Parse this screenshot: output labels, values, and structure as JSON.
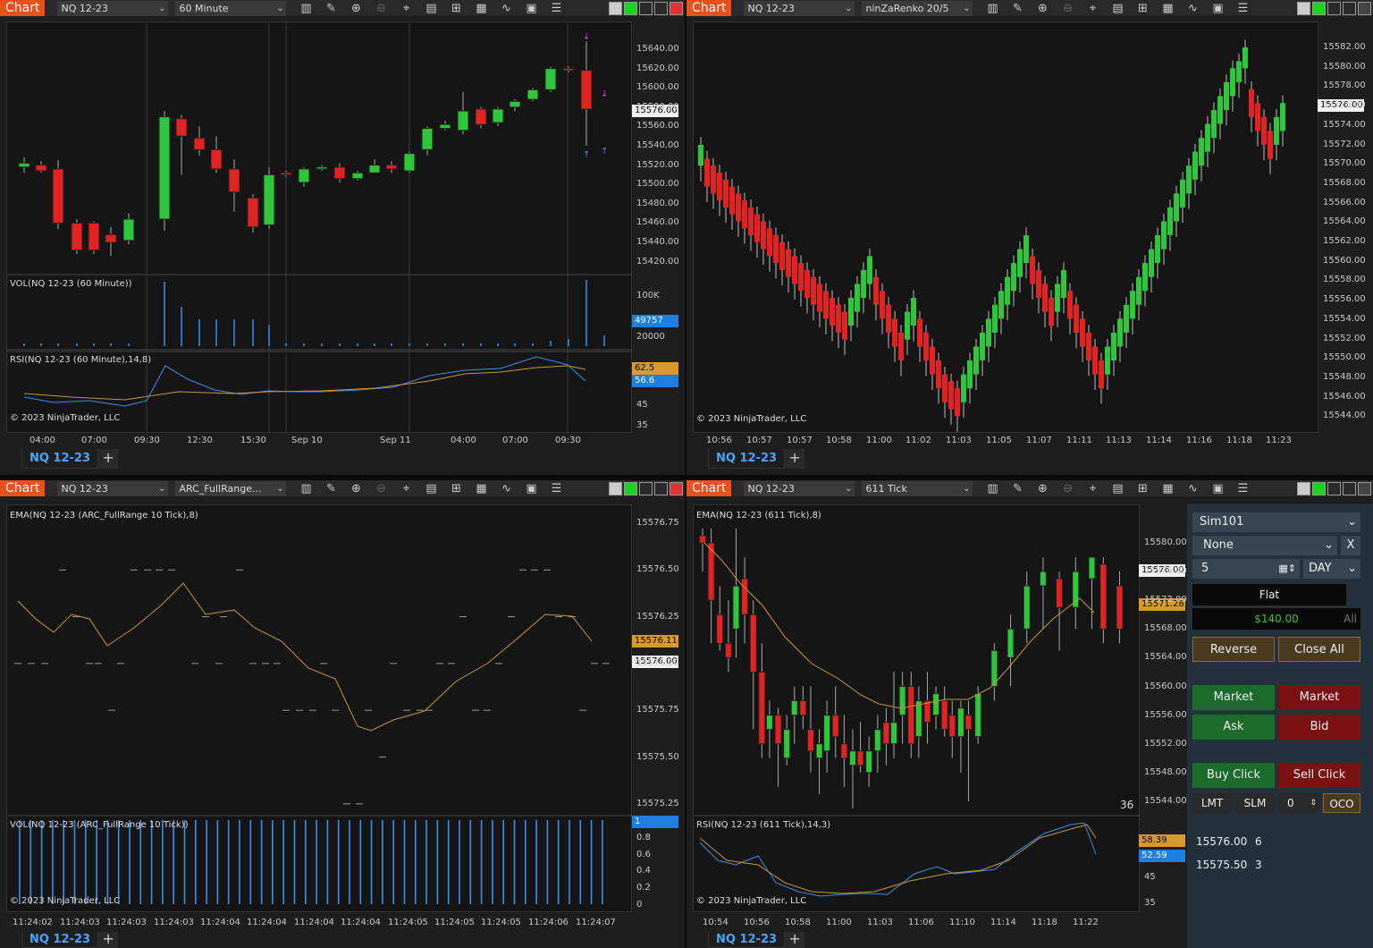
{
  "windows": [
    {
      "title": "Chart",
      "instrument": "NQ 12-23",
      "period": "60 Minute",
      "price_axis": [
        "15640.00",
        "15620.00",
        "15600.00",
        "15580.00",
        "15560.00",
        "15540.00",
        "15520.00",
        "15500.00",
        "15480.00",
        "15460.00",
        "15440.00",
        "15420.00"
      ],
      "price_tag": "15576.00",
      "vol_label": "VOL(NQ 12-23 (60 Minute))",
      "vol_axis": [
        "100K",
        "20000"
      ],
      "vol_tag": "49757",
      "rsi_label": "RSI(NQ 12-23 (60 Minute),14,8)",
      "rsi_axis": [
        "45",
        "35"
      ],
      "rsi_tag1": "62.5",
      "rsi_tag2": "56.6",
      "copyright": "© 2023 NinjaTrader, LLC",
      "time_axis": [
        "04:00",
        "07:00",
        "09:30",
        "12:30",
        "15:30",
        "Sep 10",
        "Sep 11",
        "04:00",
        "07:00",
        "09:30"
      ],
      "tab": "NQ 12-23"
    },
    {
      "title": "Chart",
      "instrument": "NQ 12-23",
      "period": "ninZaRenko 20/5",
      "price_axis": [
        "15582.00",
        "15580.00",
        "15578.00",
        "15576.00",
        "15574.00",
        "15572.00",
        "15570.00",
        "15568.00",
        "15566.00",
        "15564.00",
        "15562.00",
        "15560.00",
        "15558.00",
        "15556.00",
        "15554.00",
        "15552.00",
        "15550.00",
        "15548.00",
        "15546.00",
        "15544.00"
      ],
      "price_tag": "15576.00",
      "copyright": "© 2023 NinjaTrader, LLC",
      "time_axis": [
        "10:56",
        "10:57",
        "10:57",
        "10:58",
        "11:00",
        "11:02",
        "11:03",
        "11:05",
        "11:07",
        "11:11",
        "11:13",
        "11:14",
        "11:16",
        "11:18",
        "11:23"
      ],
      "tab": "NQ 12-23"
    },
    {
      "title": "Chart",
      "instrument": "NQ 12-23",
      "period": "ARC_FullRange...",
      "ema_label": "EMA(NQ 12-23 (ARC_FullRange  10 Tick),8)",
      "price_axis": [
        "15576.75",
        "15576.50",
        "15576.25",
        "15576.00",
        "15575.75",
        "15575.50",
        "15575.25"
      ],
      "price_tag": "15576.11",
      "price_tag2": "15576.00",
      "vol_label": "VOL(NQ 12-23 (ARC_FullRange  10 Tick))",
      "vol_axis": [
        "0.8",
        "0.6",
        "0.4",
        "0.2",
        "0"
      ],
      "vol_tag": "1",
      "copyright": "© 2023 NinjaTrader, LLC",
      "time_axis": [
        "11:24:02",
        "11:24:03",
        "11:24:03",
        "11:24:03",
        "11:24:04",
        "11:24:04",
        "11:24:04",
        "11:24:04",
        "11:24:05",
        "11:24:05",
        "11:24:05",
        "11:24:06",
        "11:24:07"
      ],
      "tab": "NQ 12-23"
    },
    {
      "title": "Chart",
      "instrument": "NQ 12-23",
      "period": "611 Tick",
      "ema_label": "EMA(NQ 12-23 (611 Tick),8)",
      "price_axis": [
        "15580.00",
        "15576.00",
        "15572.00",
        "15568.00",
        "15564.00",
        "15560.00",
        "15556.00",
        "15552.00",
        "15548.00",
        "15544.00"
      ],
      "price_tag": "15576.00",
      "price_tag2": "15571.28",
      "bar_count": "36",
      "rsi_label": "RSI(NQ 12-23 (611 Tick),14,3)",
      "rsi_axis": [
        "45",
        "35"
      ],
      "rsi_tag1": "58.39",
      "rsi_tag2": "52.59",
      "copyright": "© 2023 NinjaTrader, LLC",
      "time_axis": [
        "10:54",
        "10:56",
        "10:58",
        "11:00",
        "11:03",
        "11:06",
        "11:10",
        "11:14",
        "11:18",
        "11:22"
      ],
      "tab": "NQ 12-23"
    }
  ],
  "order_panel": {
    "account": "Sim101",
    "atm": "None",
    "atm_close": "X",
    "quantity": "5",
    "tif": "DAY",
    "position": "Flat",
    "pnl": "$140.00",
    "pnl_scope": "All",
    "reverse": "Reverse",
    "close_all": "Close All",
    "buy_market": "Market",
    "sell_market": "Market",
    "buy_ask": "Ask",
    "sell_bid": "Bid",
    "buy_click": "Buy Click",
    "sell_click": "Sell Click",
    "lmt": "LMT",
    "slm": "SLM",
    "offset": "0",
    "oco": "OCO",
    "orders": [
      {
        "price": "15576.00",
        "qty": "6"
      },
      {
        "price": "15575.50",
        "qty": "3"
      }
    ]
  },
  "colors": {
    "up": "#2ec63a",
    "down": "#e32222",
    "accent": "#e8501c",
    "vol": "#3d8ee8",
    "ema": "#c8963a",
    "tag_blue": "#1e7fe0",
    "tag_gold": "#d99a2b"
  }
}
